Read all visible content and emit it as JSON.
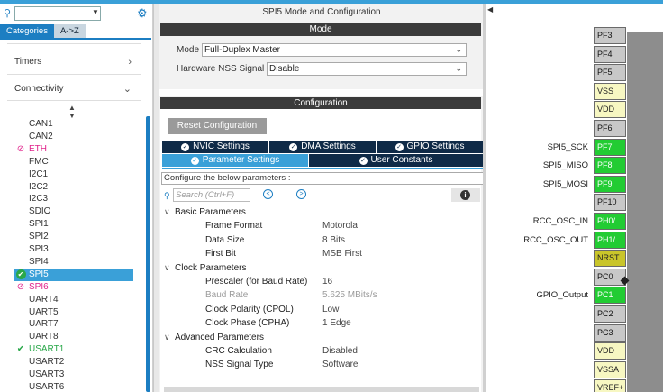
{
  "left": {
    "search_placeholder": "",
    "tabs": [
      {
        "label": "Categories",
        "active": true
      },
      {
        "label": "A->Z",
        "active": false
      }
    ],
    "categories": [
      {
        "label": "Timers",
        "arrow": ">"
      },
      {
        "label": "Connectivity",
        "arrow": "v"
      }
    ],
    "sort_icon": "sort-icon",
    "peripherals": [
      {
        "label": "CAN1",
        "status": "none"
      },
      {
        "label": "CAN2",
        "status": "none"
      },
      {
        "label": "ETH",
        "status": "conflict"
      },
      {
        "label": "FMC",
        "status": "none"
      },
      {
        "label": "I2C1",
        "status": "none"
      },
      {
        "label": "I2C2",
        "status": "none"
      },
      {
        "label": "I2C3",
        "status": "none"
      },
      {
        "label": "SDIO",
        "status": "none"
      },
      {
        "label": "SPI1",
        "status": "none"
      },
      {
        "label": "SPI2",
        "status": "none"
      },
      {
        "label": "SPI3",
        "status": "none"
      },
      {
        "label": "SPI4",
        "status": "none"
      },
      {
        "label": "SPI5",
        "status": "selected-ok"
      },
      {
        "label": "SPI6",
        "status": "conflict"
      },
      {
        "label": "UART4",
        "status": "none"
      },
      {
        "label": "UART5",
        "status": "none"
      },
      {
        "label": "UART7",
        "status": "none"
      },
      {
        "label": "UART8",
        "status": "none"
      },
      {
        "label": "USART1",
        "status": "ok"
      },
      {
        "label": "USART2",
        "status": "none"
      },
      {
        "label": "USART3",
        "status": "none"
      },
      {
        "label": "USART6",
        "status": "none"
      }
    ]
  },
  "mid": {
    "title": "SPI5 Mode and Configuration",
    "mode_header": "Mode",
    "mode_label": "Mode",
    "mode_value": "Full-Duplex Master",
    "nss_label": "Hardware NSS Signal",
    "nss_value": "Disable",
    "config_header": "Configuration",
    "reset_button": "Reset Configuration",
    "settings_tabs_row1": [
      "NVIC Settings",
      "DMA Settings",
      "GPIO Settings"
    ],
    "settings_tabs_row2": [
      "Parameter Settings",
      "User Constants"
    ],
    "configure_note": "Configure the below parameters :",
    "search_placeholder": "Search (Ctrl+F)",
    "groups": [
      {
        "label": "Basic Parameters",
        "params": [
          {
            "name": "Frame Format",
            "value": "Motorola",
            "dim": false
          },
          {
            "name": "Data Size",
            "value": "8 Bits",
            "dim": false
          },
          {
            "name": "First Bit",
            "value": "MSB First",
            "dim": false
          }
        ]
      },
      {
        "label": "Clock Parameters",
        "params": [
          {
            "name": "Prescaler (for Baud Rate)",
            "value": "16",
            "dim": false
          },
          {
            "name": "Baud Rate",
            "value": "5.625 MBits/s",
            "dim": true
          },
          {
            "name": "Clock Polarity (CPOL)",
            "value": "Low",
            "dim": false
          },
          {
            "name": "Clock Phase (CPHA)",
            "value": "1 Edge",
            "dim": false
          }
        ]
      },
      {
        "label": "Advanced Parameters",
        "params": [
          {
            "name": "CRC Calculation",
            "value": "Disabled",
            "dim": false
          },
          {
            "name": "NSS Signal Type",
            "value": "Software",
            "dim": false
          }
        ]
      }
    ]
  },
  "right": {
    "pins": [
      {
        "name": "PF3",
        "label": "",
        "color": "gray"
      },
      {
        "name": "PF4",
        "label": "",
        "color": "gray"
      },
      {
        "name": "PF5",
        "label": "",
        "color": "gray"
      },
      {
        "name": "VSS",
        "label": "",
        "color": "yellow"
      },
      {
        "name": "VDD",
        "label": "",
        "color": "yellow"
      },
      {
        "name": "PF6",
        "label": "",
        "color": "gray"
      },
      {
        "name": "PF7",
        "label": "SPI5_SCK",
        "color": "green"
      },
      {
        "name": "PF8",
        "label": "SPI5_MISO",
        "color": "green"
      },
      {
        "name": "PF9",
        "label": "SPI5_MOSI",
        "color": "green"
      },
      {
        "name": "PF10",
        "label": "",
        "color": "gray"
      },
      {
        "name": "PH0/..",
        "label": "RCC_OSC_IN",
        "color": "green"
      },
      {
        "name": "PH1/..",
        "label": "RCC_OSC_OUT",
        "color": "green"
      },
      {
        "name": "NRST",
        "label": "",
        "color": "olive"
      },
      {
        "name": "PC0",
        "label": "",
        "color": "gray"
      },
      {
        "name": "PC1",
        "label": "GPIO_Output",
        "color": "green"
      },
      {
        "name": "PC2",
        "label": "",
        "color": "gray"
      },
      {
        "name": "PC3",
        "label": "",
        "color": "gray"
      },
      {
        "name": "VDD",
        "label": "",
        "color": "yellow"
      },
      {
        "name": "VSSA",
        "label": "",
        "color": "yellow"
      },
      {
        "name": "VREF+",
        "label": "",
        "color": "yellow"
      }
    ]
  }
}
